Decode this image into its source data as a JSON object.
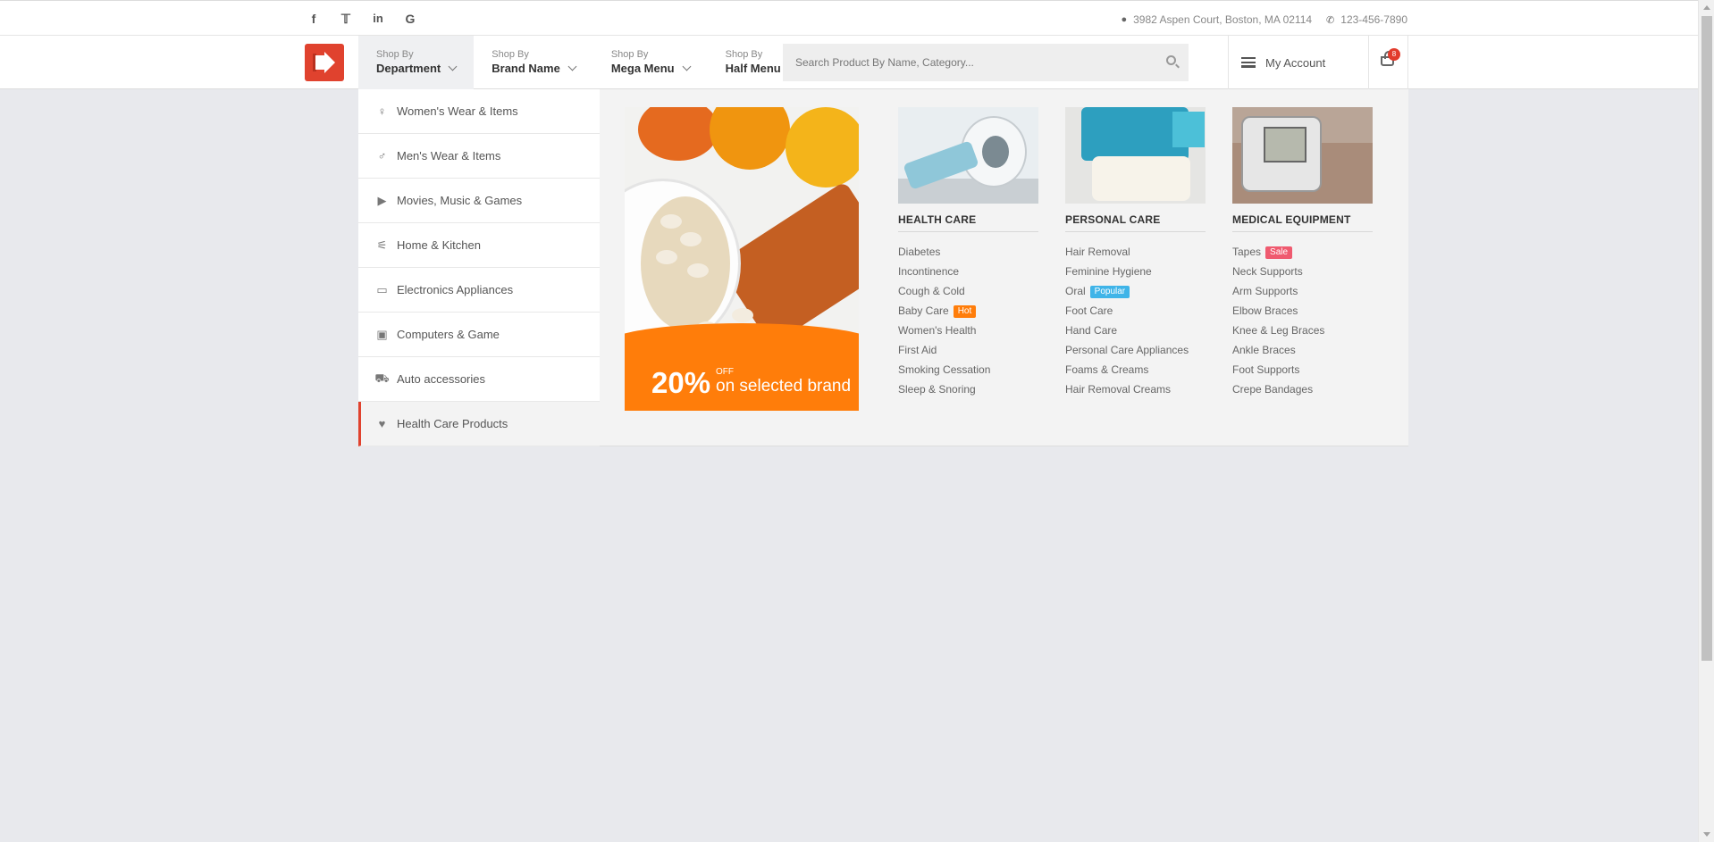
{
  "topbar": {
    "social": [
      {
        "name": "facebook-icon",
        "glyph": "f"
      },
      {
        "name": "twitter-icon",
        "glyph": "❧"
      },
      {
        "name": "linkedin-icon",
        "glyph": "in"
      },
      {
        "name": "google-icon",
        "glyph": "G"
      }
    ],
    "address": "3982 Aspen Court, Boston, MA 02114",
    "phone": "123-456-7890"
  },
  "nav": [
    {
      "small": "Shop By",
      "big": "Department"
    },
    {
      "small": "Shop By",
      "big": "Brand Name"
    },
    {
      "small": "Shop By",
      "big": "Mega Menu"
    },
    {
      "small": "Shop By",
      "big": "Half Menu"
    }
  ],
  "search": {
    "placeholder": "Search Product By Name, Category..."
  },
  "account": {
    "label": "My Account"
  },
  "cart": {
    "count": "8"
  },
  "departments": [
    {
      "label": "Women's Wear & Items",
      "icon": "woman-icon"
    },
    {
      "label": "Men's Wear & Items",
      "icon": "man-icon"
    },
    {
      "label": "Movies, Music & Games",
      "icon": "play-icon"
    },
    {
      "label": "Home & Kitchen",
      "icon": "cutlery-icon"
    },
    {
      "label": "Electronics Appliances",
      "icon": "monitor-icon"
    },
    {
      "label": "Computers & Game",
      "icon": "laptop-icon"
    },
    {
      "label": "Auto accessories",
      "icon": "car-icon"
    },
    {
      "label": "Health Care Products",
      "icon": "heartbeat-icon"
    }
  ],
  "promo": {
    "percent": "20%",
    "off": "OFF",
    "text": "on selected brand"
  },
  "categories": [
    {
      "title": "HEALTH CARE",
      "items": [
        "Diabetes",
        "Incontinence",
        "Cough & Cold",
        "Baby Care",
        "Women's Health",
        "First Aid",
        "Smoking Cessation",
        "Sleep & Snoring"
      ],
      "tags": {
        "Baby Care": "Hot"
      }
    },
    {
      "title": "PERSONAL CARE",
      "items": [
        "Hair Removal",
        "Feminine Hygiene",
        "Oral",
        "Foot Care",
        "Hand Care",
        "Personal Care Appliances",
        "Foams & Creams",
        "Hair Removal Creams"
      ],
      "tags": {
        "Oral": "Popular"
      }
    },
    {
      "title": "MEDICAL EQUIPMENT",
      "items": [
        "Tapes",
        "Neck Supports",
        "Arm Supports",
        "Elbow Braces",
        "Knee & Leg Braces",
        "Ankle Braces",
        "Foot Supports",
        "Crepe Bandages"
      ],
      "tags": {
        "Tapes": "Sale"
      }
    }
  ],
  "colors": {
    "accent": "#e0422e",
    "promo": "#ff7d0a",
    "hot": "#ff7d0a",
    "sale": "#ef5a6f",
    "popular": "#3fb4e8"
  }
}
